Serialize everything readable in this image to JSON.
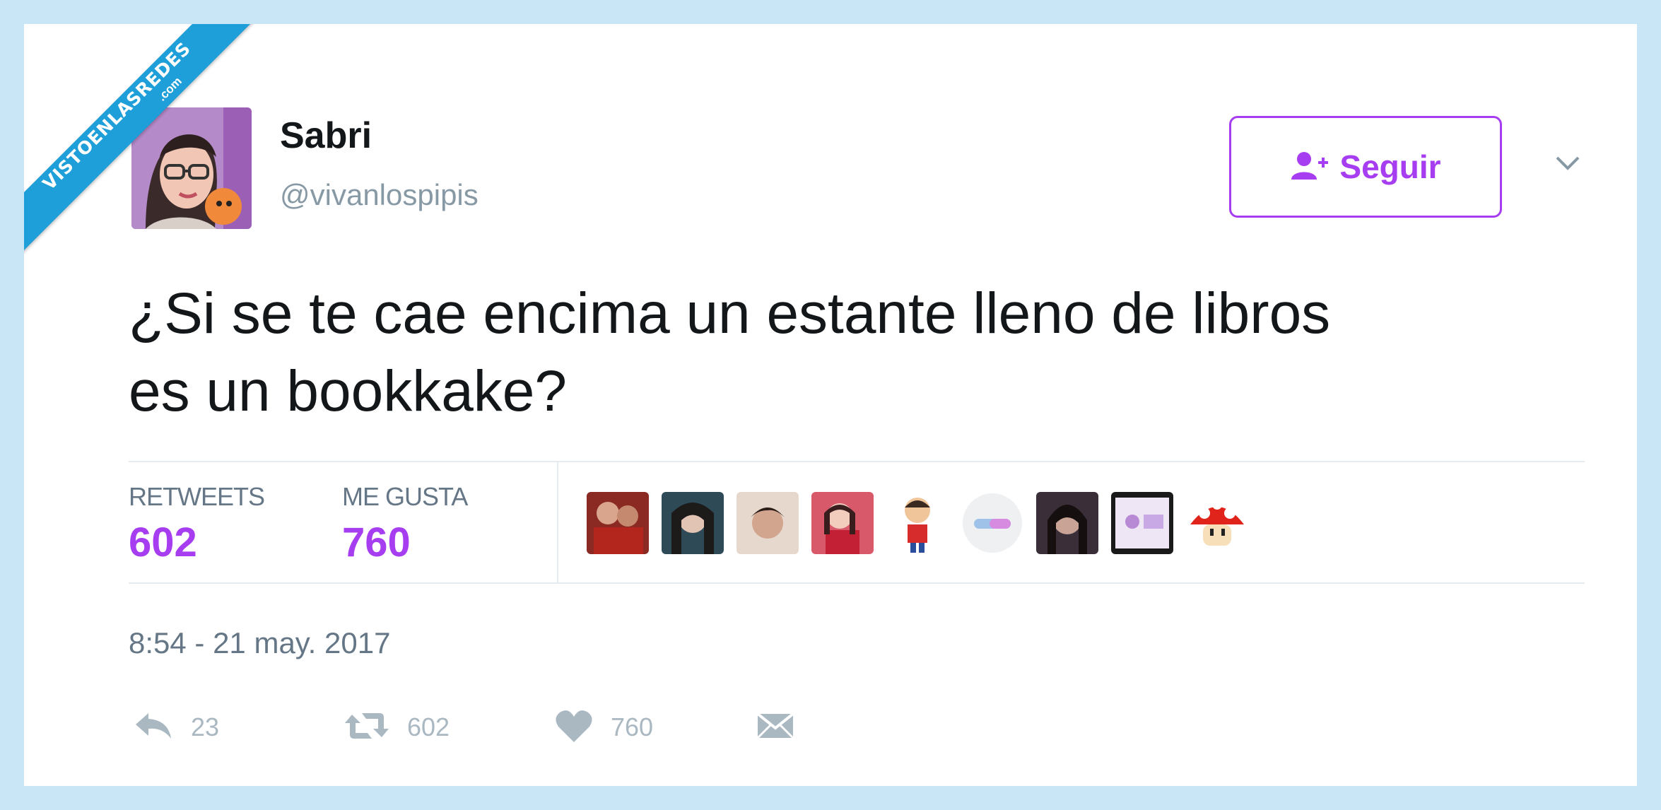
{
  "watermark": {
    "line1": "VISTOENLASREDES",
    "line2": ".com"
  },
  "user": {
    "name": "Sabri",
    "handle": "@vivanlospipis"
  },
  "follow_button": {
    "label": "Seguir",
    "icon": "add-user-icon"
  },
  "menu": {
    "icon": "chevron-down-icon"
  },
  "tweet": {
    "line1": "¿Si se te cae encima un estante lleno de libros",
    "line2": "es un bookkake?"
  },
  "stats": {
    "retweets_label": "RETWEETS",
    "retweets_value": "602",
    "likes_label": "ME GUSTA",
    "likes_value": "760"
  },
  "timestamp": "8:54 - 21 may. 2017",
  "actions": {
    "reply": {
      "icon": "reply-icon",
      "count": "23"
    },
    "retweet": {
      "icon": "retweet-icon",
      "count": "602"
    },
    "like": {
      "icon": "heart-icon",
      "count": "760"
    },
    "message": {
      "icon": "direct-message-icon"
    }
  },
  "colors": {
    "accent": "#a73df0",
    "text": "#14171a",
    "muted": "#657786",
    "frame": "#c9e6f7"
  }
}
